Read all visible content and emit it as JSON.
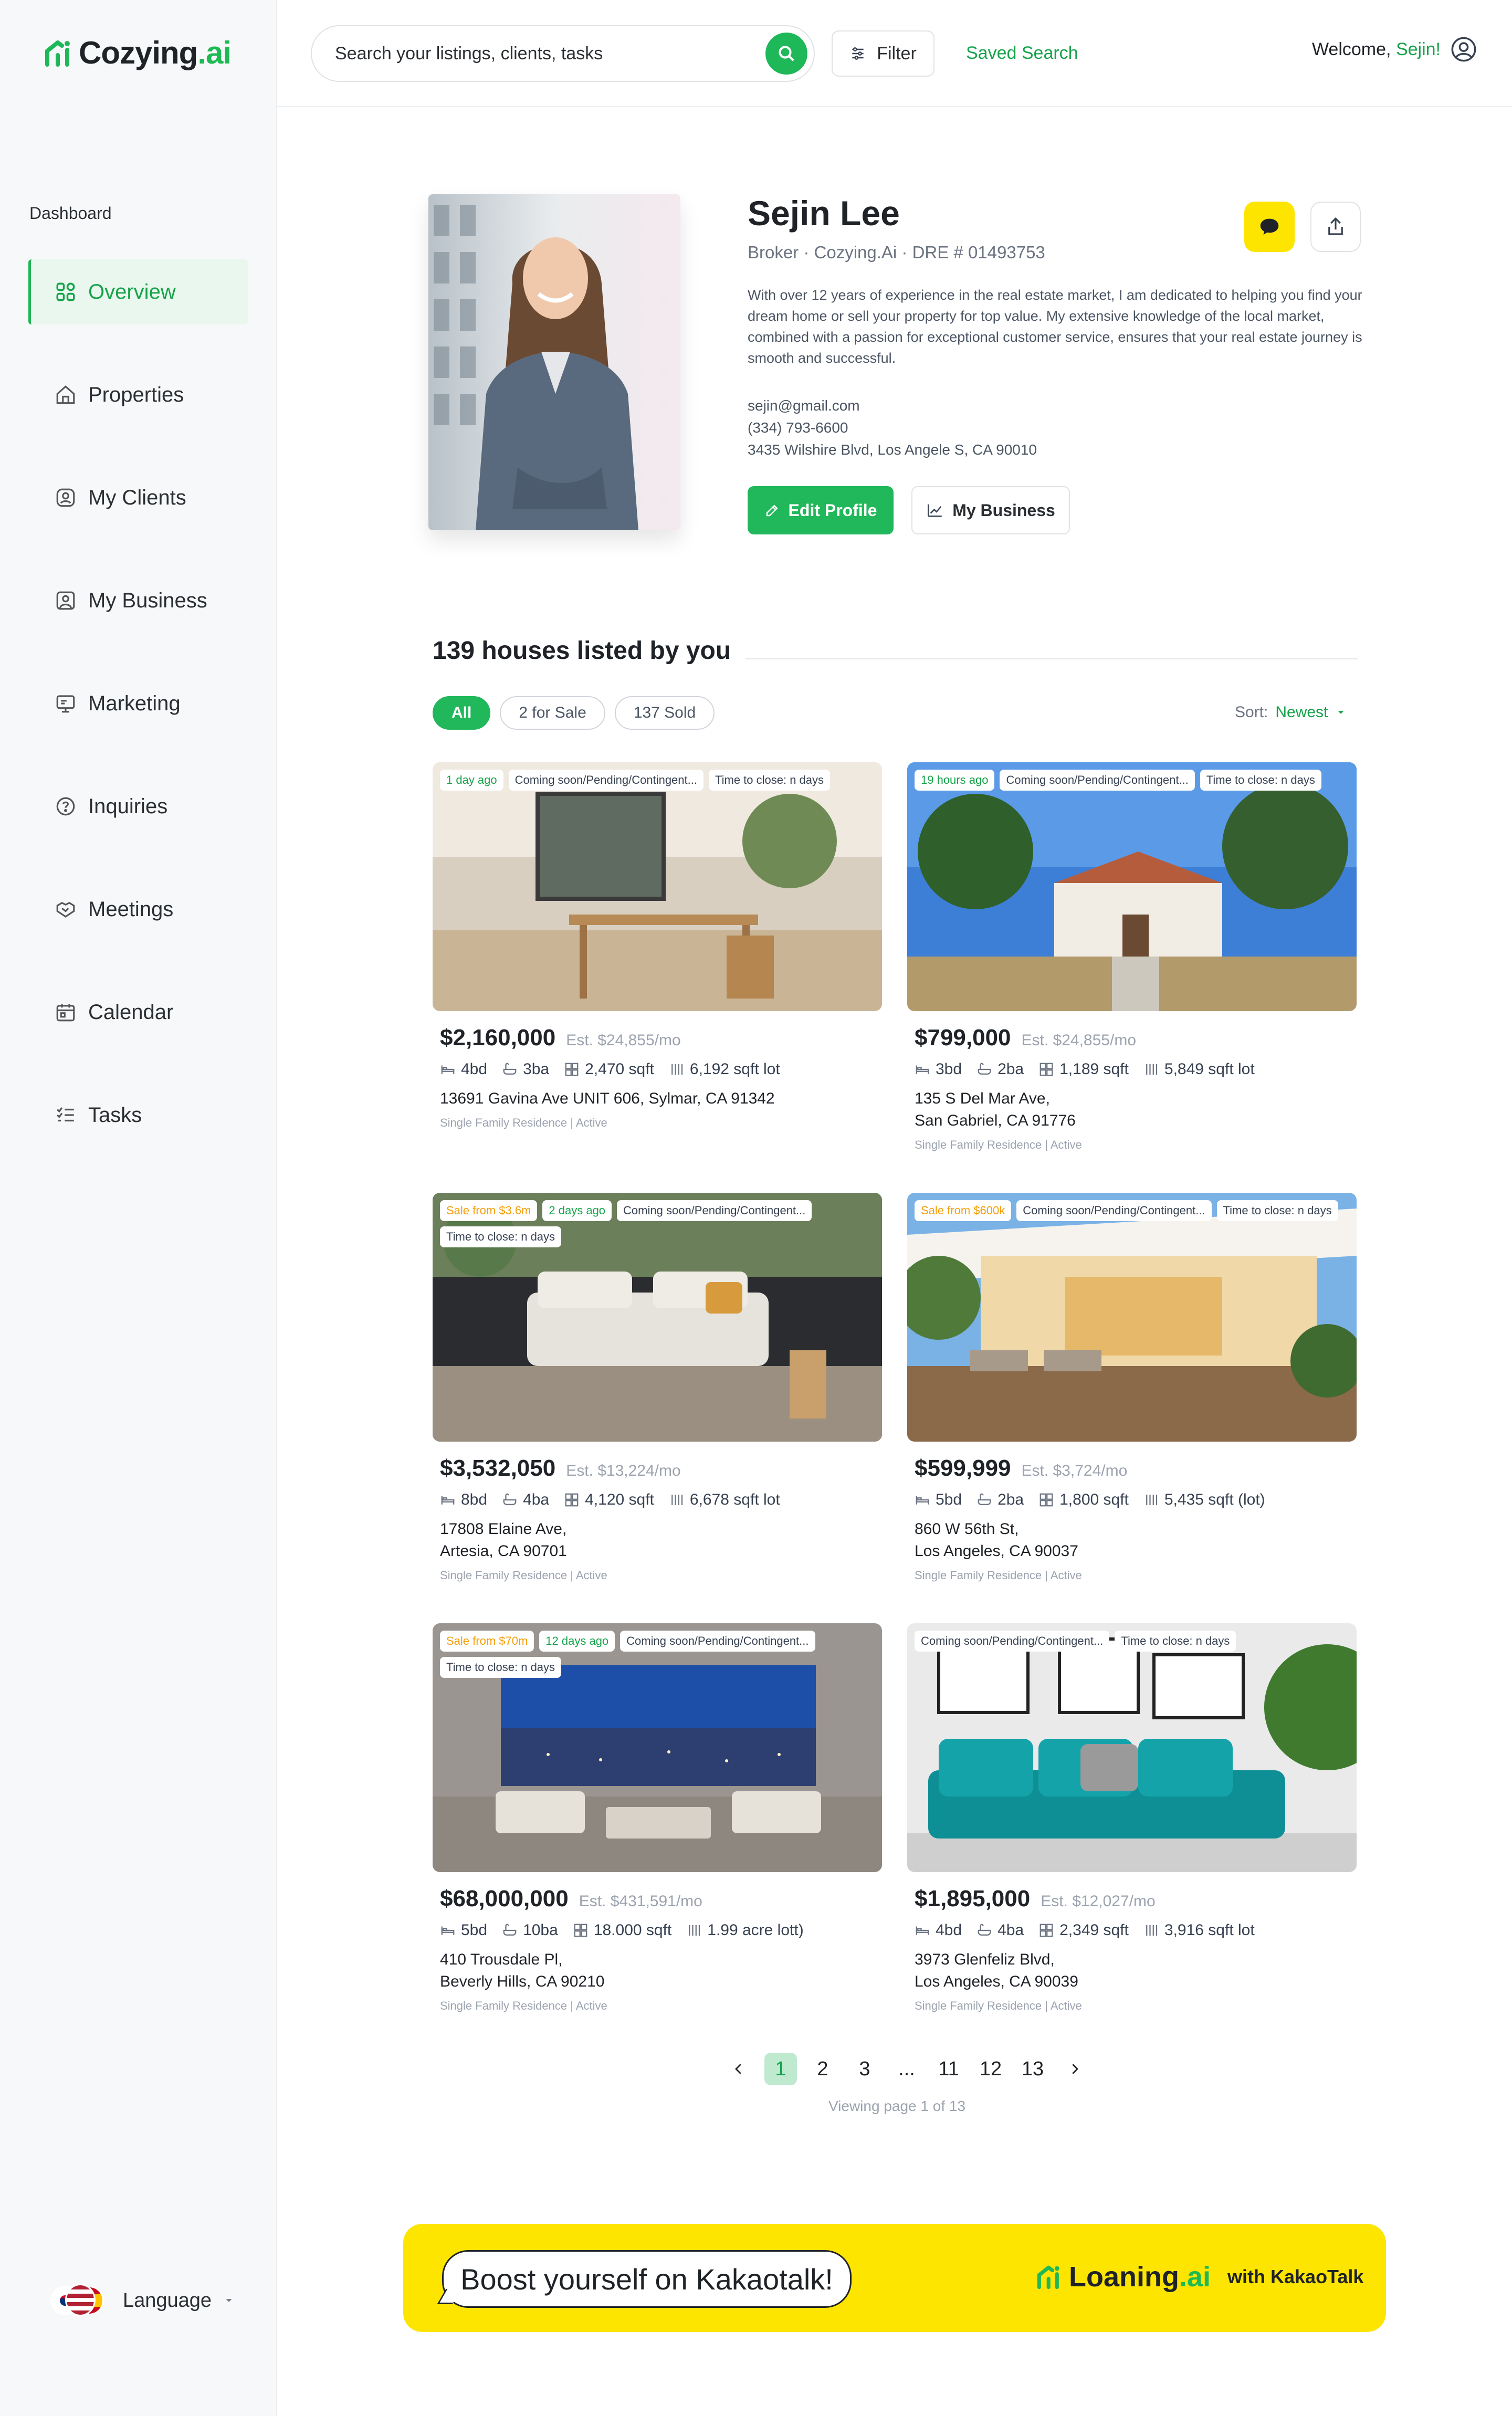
{
  "app": {
    "logo_name": "Cozying",
    "logo_suffix": ".ai",
    "brand_color": "#1fb859"
  },
  "sidebar": {
    "caption": "Dashboard",
    "items": [
      {
        "label": "Overview",
        "icon": "grid-icon",
        "active": true
      },
      {
        "label": "Properties",
        "icon": "home-icon"
      },
      {
        "label": "My Clients",
        "icon": "clients-icon"
      },
      {
        "label": "My Business",
        "icon": "business-icon"
      },
      {
        "label": "Marketing",
        "icon": "marketing-icon"
      },
      {
        "label": "Inquiries",
        "icon": "question-icon"
      },
      {
        "label": "Meetings",
        "icon": "handshake-icon"
      },
      {
        "label": "Calendar",
        "icon": "calendar-icon"
      },
      {
        "label": "Tasks",
        "icon": "tasks-icon"
      }
    ],
    "language_label": "Language"
  },
  "topbar": {
    "search_placeholder": "Search your listings, clients, tasks",
    "filter_label": "Filter",
    "saved_search_label": "Saved Search",
    "welcome_prefix": "Welcome,",
    "welcome_name": "Sejin!"
  },
  "profile": {
    "name": "Sejin Lee",
    "meta": "Broker · Cozying.Ai · DRE # 01493753",
    "bio": "With over 12 years of experience in the real estate market, I am dedicated to helping you find your dream home or sell your property for top value. My extensive knowledge of the local market, combined with a passion for exceptional customer service, ensures that your real estate journey is smooth and successful.",
    "email": "sejin@gmail.com",
    "phone": "(334) 793-6600",
    "address": "3435 Wilshire Blvd, Los Angele S, CA 90010",
    "edit_label": "Edit Profile",
    "business_label": "My Business"
  },
  "listings": {
    "heading": "139 houses listed by you",
    "filters": [
      "All",
      "2 for Sale",
      "137 Sold"
    ],
    "sort_label": "Sort:",
    "sort_value": "Newest",
    "cards": [
      {
        "tags": [
          {
            "t": "1 day ago",
            "c": "g"
          },
          {
            "t": "Coming soon/Pending/Contingent...",
            "c": ""
          },
          {
            "t": "Time to close: n days",
            "c": ""
          }
        ],
        "price": "$2,160,000",
        "est": "Est. $24,855/mo",
        "bd": "4bd",
        "ba": "3ba",
        "sqft": "2,470 sqft",
        "lot": "6,192 sqft lot",
        "addr1": "13691 Gavina Ave UNIT 606, Sylmar, CA 91342",
        "addr2": "",
        "sub": "Single Family Residence | Active"
      },
      {
        "tags": [
          {
            "t": "19 hours ago",
            "c": "g"
          },
          {
            "t": "Coming soon/Pending/Contingent...",
            "c": ""
          },
          {
            "t": "Time to close: n days",
            "c": ""
          }
        ],
        "price": "$799,000",
        "est": "Est. $24,855/mo",
        "bd": "3bd",
        "ba": "2ba",
        "sqft": "1,189 sqft",
        "lot": "5,849 sqft  lot",
        "addr1": "135 S Del Mar Ave,",
        "addr2": "San Gabriel, CA 91776",
        "sub": "Single Family Residence | Active"
      },
      {
        "tags": [
          {
            "t": "Sale from $3.6m",
            "c": "o"
          },
          {
            "t": "2 days ago",
            "c": "g"
          },
          {
            "t": "Coming soon/Pending/Contingent...",
            "c": ""
          },
          {
            "t": "Time to close: n days",
            "c": ""
          }
        ],
        "price": "$3,532,050",
        "est": "Est. $13,224/mo",
        "bd": "8bd",
        "ba": "4ba",
        "sqft": "4,120 sqft",
        "lot": "6,678 sqft  lot",
        "addr1": "17808 Elaine Ave,",
        "addr2": "Artesia, CA 90701",
        "sub": "Single Family Residence | Active"
      },
      {
        "tags": [
          {
            "t": "Sale from $600k",
            "c": "o"
          },
          {
            "t": "Coming soon/Pending/Contingent...",
            "c": ""
          },
          {
            "t": "Time to close: n days",
            "c": ""
          }
        ],
        "price": "$599,999",
        "est": "Est. $3,724/mo",
        "bd": "5bd",
        "ba": "2ba",
        "sqft": "1,800 sqft",
        "lot": "5,435 sqft (lot)",
        "addr1": "860 W 56th St,",
        "addr2": "Los Angeles, CA 90037",
        "sub": "Single Family Residence | Active"
      },
      {
        "tags": [
          {
            "t": "Sale from $70m",
            "c": "o"
          },
          {
            "t": "12 days ago",
            "c": "g"
          },
          {
            "t": "Coming soon/Pending/Contingent...",
            "c": ""
          },
          {
            "t": "Time to close: n days",
            "c": ""
          }
        ],
        "price": "$68,000,000",
        "est": "Est. $431,591/mo",
        "bd": "5bd",
        "ba": "10ba",
        "sqft": "18.000 sqft",
        "lot": "1.99 acre  lott)",
        "addr1": "410 Trousdale Pl,",
        "addr2": "Beverly Hills, CA 90210",
        "sub": "Single Family Residence | Active"
      },
      {
        "tags": [
          {
            "t": "Coming soon/Pending/Contingent...",
            "c": ""
          },
          {
            "t": "Time to close: n days",
            "c": ""
          }
        ],
        "price": "$1,895,000",
        "est": "Est. $12,027/mo",
        "bd": "4bd",
        "ba": "4ba",
        "sqft": "2,349 sqft",
        "lot": "3,916 sqft  lot",
        "addr1": "3973 Glenfeliz Blvd,",
        "addr2": "Los Angeles, CA 90039",
        "sub": "Single Family Residence | Active"
      }
    ]
  },
  "pagination": {
    "pages": [
      "1",
      "2",
      "3",
      "...",
      "11",
      "12",
      "13"
    ],
    "current": "1",
    "info": "Viewing page 1 of 13"
  },
  "banner": {
    "bubble_text": "Boost yourself on Kakaotalk!",
    "brand_name": "Loaning",
    "brand_suffix": ".ai",
    "brand_tail": "with KakaoTalk",
    "color": "#fee500"
  }
}
